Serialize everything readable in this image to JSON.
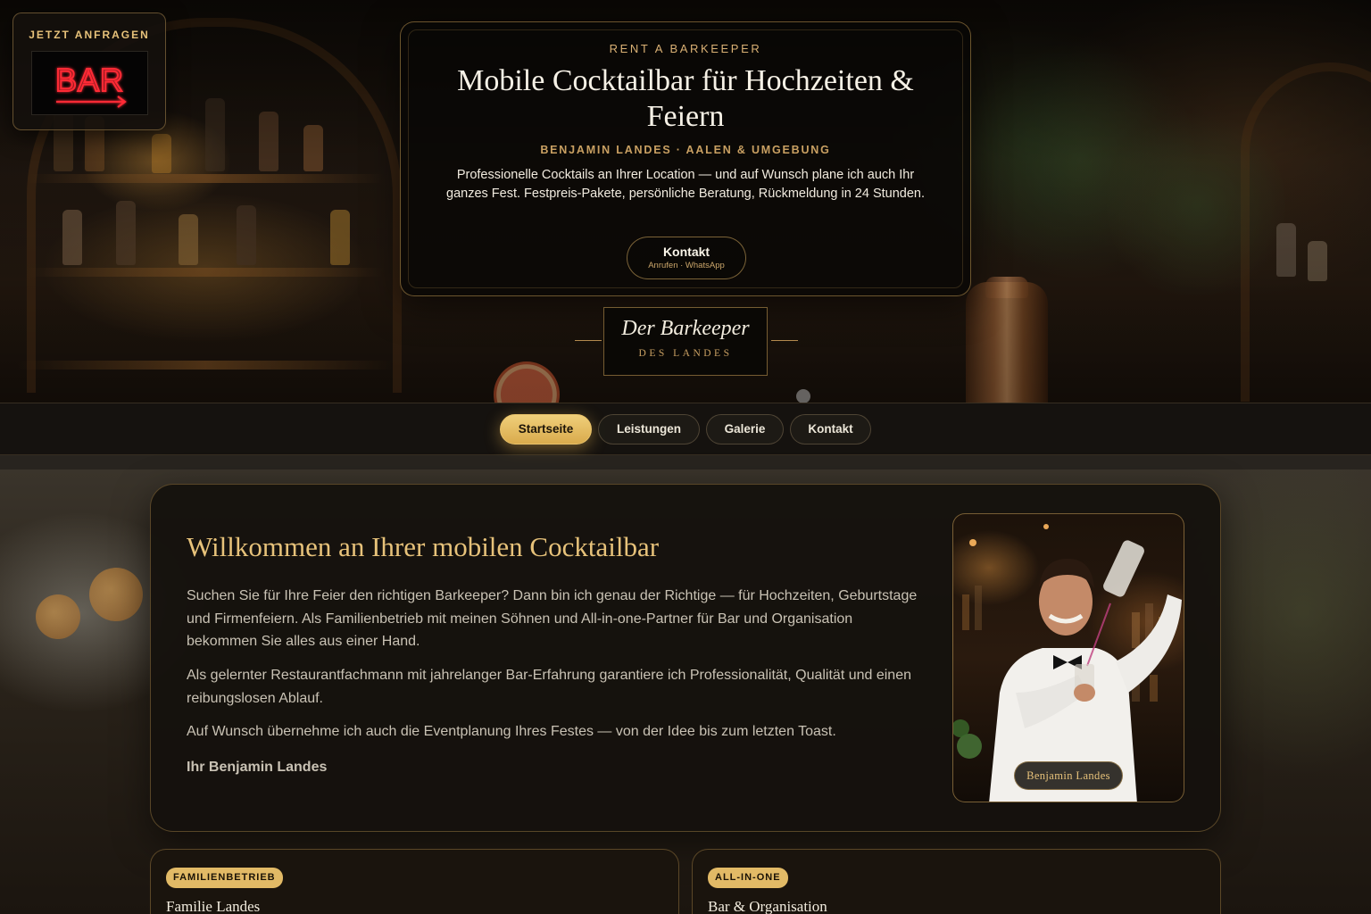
{
  "cta": {
    "title": "JETZT ANFRAGEN",
    "neon_text": "BAR",
    "neon_color": "#ff2a36"
  },
  "hero": {
    "eyebrow": "RENT A BARKEEPER",
    "title": "Mobile Cocktailbar für Hochzeiten & Feiern",
    "subtitle": "BENJAMIN LANDES · AALEN & UMGEBUNG",
    "description": "Professionelle Cocktails an Ihrer Location — und auf Wunsch plane ich auch Ihr ganzes Fest. Festpreis-Pakete, persönliche Beratung, Rückmeldung in 24 Stunden.",
    "contact_label": "Kontakt",
    "contact_sub": "Anrufen · WhatsApp"
  },
  "logo": {
    "main": "Der Barkeeper",
    "sub": "DES LANDES"
  },
  "nav": {
    "items": [
      {
        "label": "Startseite",
        "active": true
      },
      {
        "label": "Leistungen",
        "active": false
      },
      {
        "label": "Galerie",
        "active": false
      },
      {
        "label": "Kontakt",
        "active": false
      }
    ]
  },
  "welcome": {
    "title": "Willkommen an Ihrer mobilen Cocktailbar",
    "paragraphs": [
      "Suchen Sie für Ihre Feier den richtigen Barkeeper? Dann bin ich genau der Richtige — für Hochzeiten, Geburtstage und Firmenfeiern. Als Familienbetrieb mit meinen Söhnen und All-in-one-Partner für Bar und Organisation bekommen Sie alles aus einer Hand.",
      "Als gelernter Restaurantfachmann mit jahrelanger Bar-Erfahrung garantiere ich Professionalität, Qualität und einen reibungslosen Ablauf.",
      "Auf Wunsch übernehme ich auch die Eventplanung Ihres Festes — von der Idee bis zum letzten Toast."
    ],
    "signature": "Ihr Benjamin Landes",
    "photo_caption": "Benjamin Landes"
  },
  "features": [
    {
      "badge": "FAMILIENBETRIEB",
      "title": "Familie Landes"
    },
    {
      "badge": "ALL-IN-ONE",
      "title": "Bar & Organisation"
    }
  ],
  "colors": {
    "accent_gold": "#e7c27a",
    "active_pill": "#e2ba66",
    "background": "#0b0906"
  }
}
